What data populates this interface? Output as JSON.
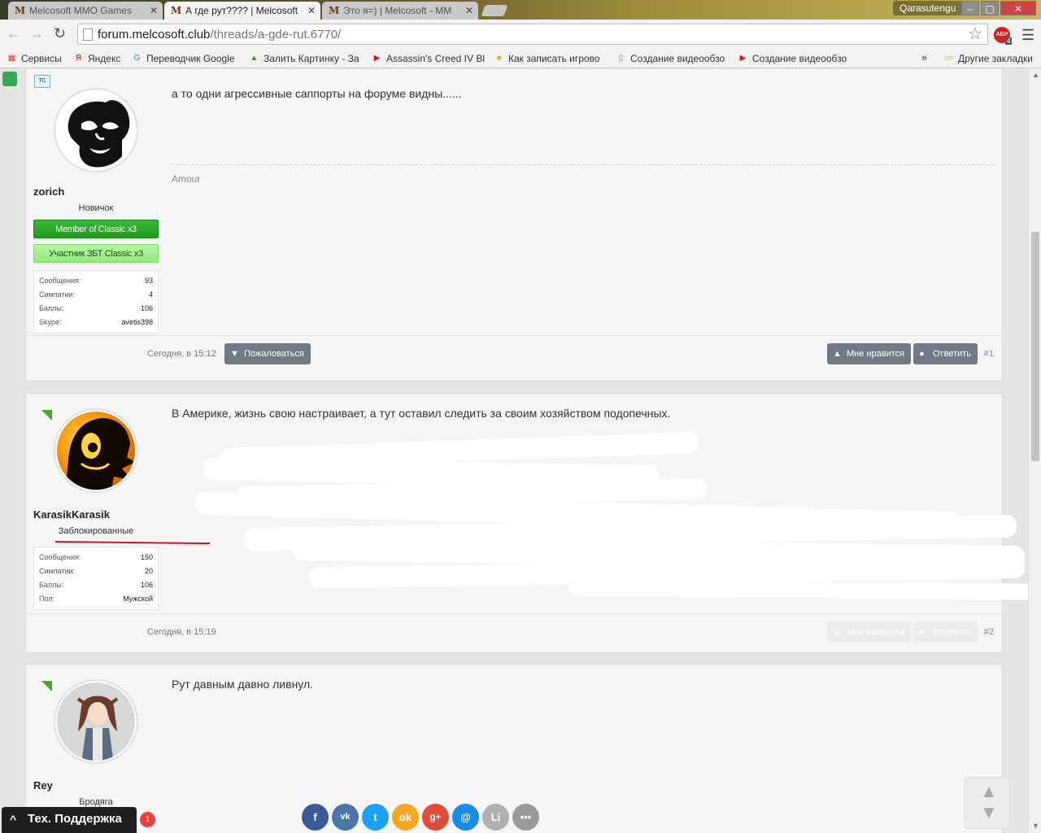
{
  "browser": {
    "tabs": [
      {
        "title": "Melcosoft MMO Games",
        "active": false
      },
      {
        "title": "А где рут???? | Melcosoft",
        "active": true
      },
      {
        "title": "Это я=) | Melcosoft - MM",
        "active": false
      }
    ],
    "user": "Qarasutengu",
    "url_host": "forum.melcosoft.club",
    "url_path": "/threads/a-gde-rut.6770/",
    "abp_count": "4",
    "bookmarks": [
      "Сервисы",
      "Яндекс",
      "Переводчик Google",
      "Залить Картинку - За",
      "Assassin's Creed IV Bl",
      "Как записать игрово",
      "Создание видеообзо",
      "Создание видеообзо"
    ],
    "other_bookmarks": "Другие закладки"
  },
  "posts": [
    {
      "author": "zorich",
      "user_title": "Новичок",
      "banners": [
        "Member of Classic x3",
        "Участник ЗБТ Classic x3"
      ],
      "stats": [
        {
          "label": "Сообщения:",
          "value": "93"
        },
        {
          "label": "Симпатии:",
          "value": "4"
        },
        {
          "label": "Баллы:",
          "value": "106"
        },
        {
          "label": "Skype:",
          "value": "avetis398"
        }
      ],
      "message": "а то одни агрессивные саппорты на форуме видны......",
      "signature": "Amour",
      "date": "Сегодня, в 15:12",
      "report_label": "Пожаловаться",
      "like_label": "Мне нравится",
      "reply_label": "Ответить",
      "number": "#1",
      "starter_badge": "TC"
    },
    {
      "author": "KarasikKarasik",
      "user_title": "Заблокированные",
      "stats": [
        {
          "label": "Сообщения:",
          "value": "150"
        },
        {
          "label": "Симпатии:",
          "value": "20"
        },
        {
          "label": "Баллы:",
          "value": "106"
        },
        {
          "label": "Пол:",
          "value": "Мужской"
        }
      ],
      "message": "В Америке, жизнь свою настраивает, а тут оставил следить за своим хозяйством подопечных.",
      "date": "Сегодня, в 15:19",
      "like_label": "Мне нравится",
      "reply_label": "Ответить",
      "number": "#2"
    },
    {
      "author": "Rey",
      "user_title": "Бродяга",
      "message": "Рут давным давно ливнул."
    }
  ],
  "support": {
    "label": "Тех. Поддержка",
    "count": "1"
  },
  "share_icons": [
    "facebook-icon",
    "vk-icon",
    "twitter-icon",
    "odnoklassniki-icon",
    "google-plus-icon",
    "mailru-icon",
    "liveinternet-icon",
    "more-icon"
  ],
  "colors": {
    "badge_green": "#2aa52a",
    "badge_light": "#a6f291",
    "button": "#717a84",
    "online": "#4aa820",
    "blocked_underline": "#c21c1c"
  }
}
